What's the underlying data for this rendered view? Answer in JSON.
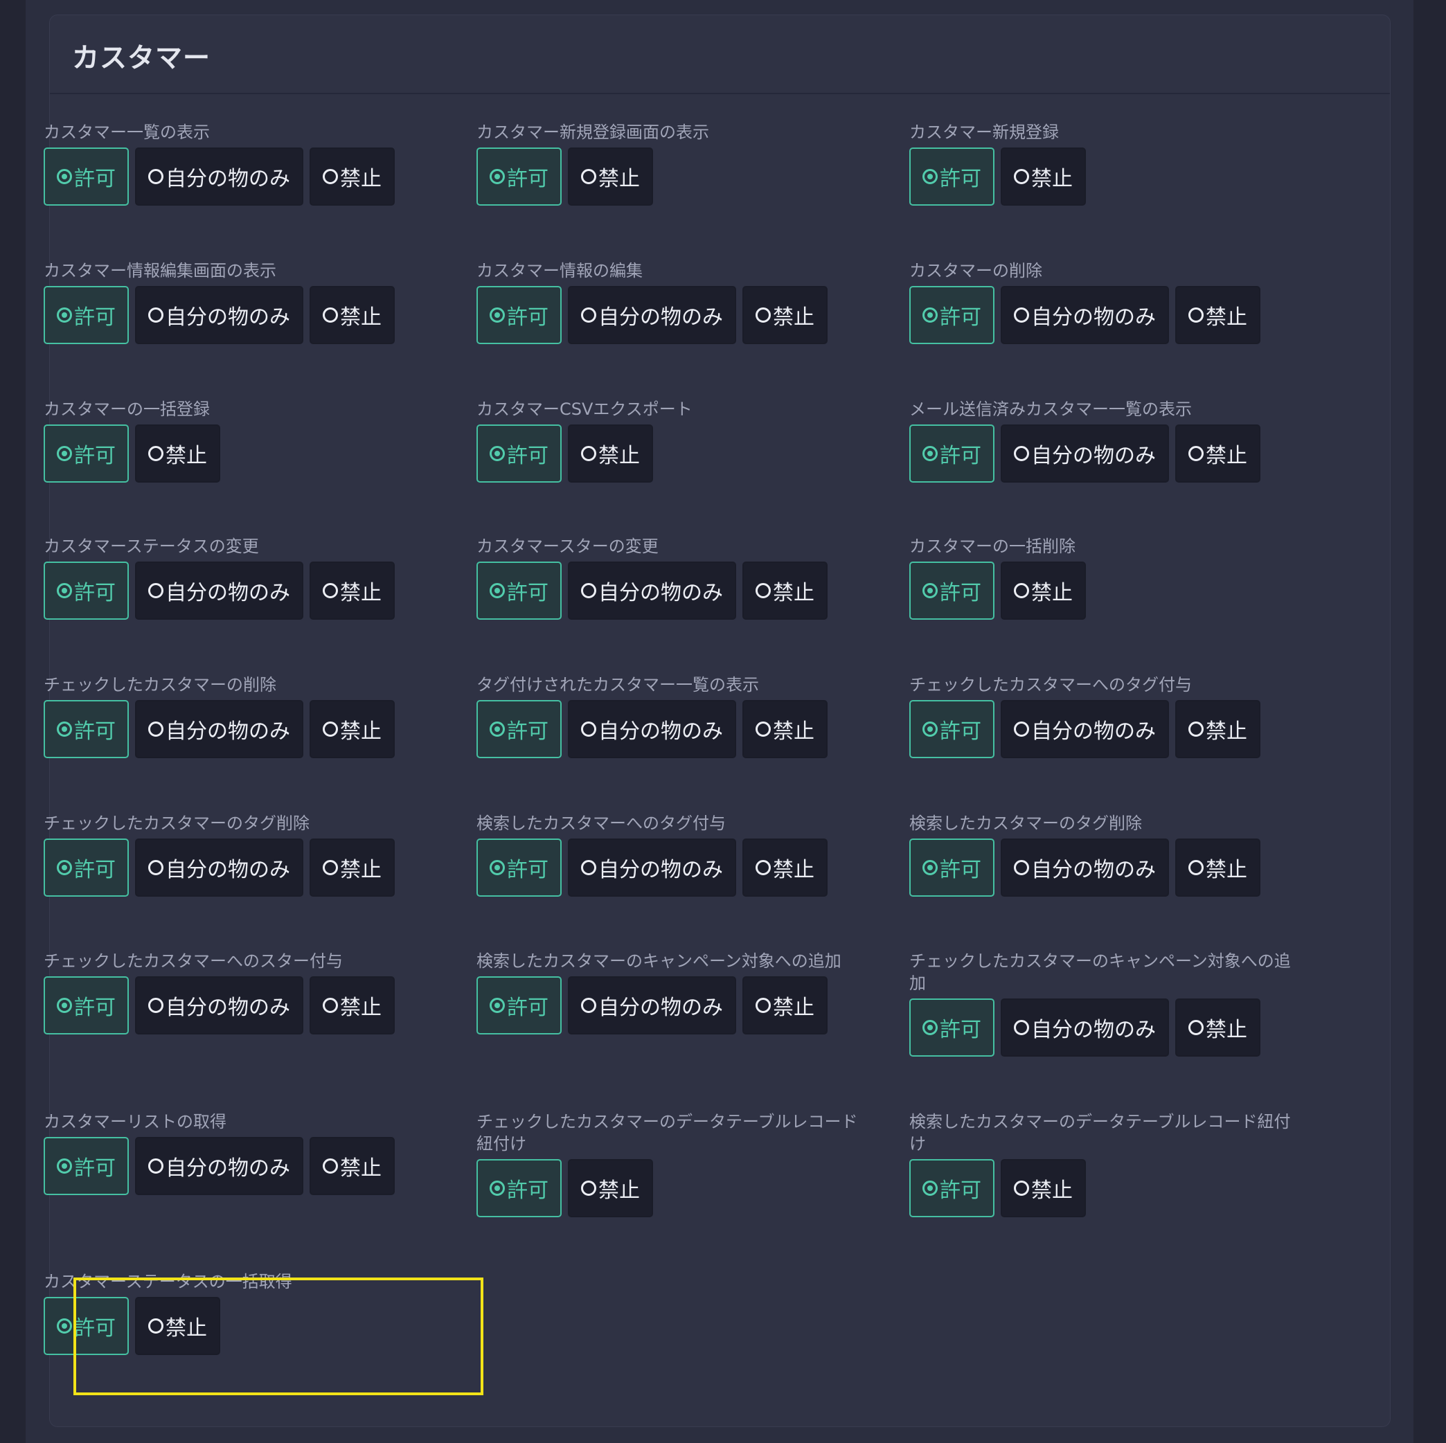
{
  "card": {
    "title": "カスタマー"
  },
  "colors": {
    "accent": "#45c0a2",
    "highlight": "#f2e318"
  },
  "option_labels": {
    "allow": "許可",
    "own": "自分の物のみ",
    "deny": "禁止"
  },
  "permissions": [
    {
      "label": "カスタマー一覧の表示",
      "options": [
        "allow",
        "own",
        "deny"
      ],
      "selected": "allow"
    },
    {
      "label": "カスタマー新規登録画面の表示",
      "options": [
        "allow",
        "deny"
      ],
      "selected": "allow"
    },
    {
      "label": "カスタマー新規登録",
      "options": [
        "allow",
        "deny"
      ],
      "selected": "allow"
    },
    {
      "label": "カスタマー情報編集画面の表示",
      "options": [
        "allow",
        "own",
        "deny"
      ],
      "selected": "allow"
    },
    {
      "label": "カスタマー情報の編集",
      "options": [
        "allow",
        "own",
        "deny"
      ],
      "selected": "allow"
    },
    {
      "label": "カスタマーの削除",
      "options": [
        "allow",
        "own",
        "deny"
      ],
      "selected": "allow"
    },
    {
      "label": "カスタマーの一括登録",
      "options": [
        "allow",
        "deny"
      ],
      "selected": "allow"
    },
    {
      "label": "カスタマーCSVエクスポート",
      "options": [
        "allow",
        "deny"
      ],
      "selected": "allow"
    },
    {
      "label": "メール送信済みカスタマー一覧の表示",
      "options": [
        "allow",
        "own",
        "deny"
      ],
      "selected": "allow"
    },
    {
      "label": "カスタマーステータスの変更",
      "options": [
        "allow",
        "own",
        "deny"
      ],
      "selected": "allow"
    },
    {
      "label": "カスタマースターの変更",
      "options": [
        "allow",
        "own",
        "deny"
      ],
      "selected": "allow"
    },
    {
      "label": "カスタマーの一括削除",
      "options": [
        "allow",
        "deny"
      ],
      "selected": "allow"
    },
    {
      "label": "チェックしたカスタマーの削除",
      "options": [
        "allow",
        "own",
        "deny"
      ],
      "selected": "allow"
    },
    {
      "label": "タグ付けされたカスタマー一覧の表示",
      "options": [
        "allow",
        "own",
        "deny"
      ],
      "selected": "allow"
    },
    {
      "label": "チェックしたカスタマーへのタグ付与",
      "options": [
        "allow",
        "own",
        "deny"
      ],
      "selected": "allow"
    },
    {
      "label": "チェックしたカスタマーのタグ削除",
      "options": [
        "allow",
        "own",
        "deny"
      ],
      "selected": "allow"
    },
    {
      "label": "検索したカスタマーへのタグ付与",
      "options": [
        "allow",
        "own",
        "deny"
      ],
      "selected": "allow"
    },
    {
      "label": "検索したカスタマーのタグ削除",
      "options": [
        "allow",
        "own",
        "deny"
      ],
      "selected": "allow"
    },
    {
      "label": "チェックしたカスタマーへのスター付与",
      "options": [
        "allow",
        "own",
        "deny"
      ],
      "selected": "allow"
    },
    {
      "label": "検索したカスタマーのキャンペーン対象への追加",
      "options": [
        "allow",
        "own",
        "deny"
      ],
      "selected": "allow"
    },
    {
      "label": "チェックしたカスタマーのキャンペーン対象への追加",
      "options": [
        "allow",
        "own",
        "deny"
      ],
      "selected": "allow"
    },
    {
      "label": "カスタマーリストの取得",
      "options": [
        "allow",
        "own",
        "deny"
      ],
      "selected": "allow"
    },
    {
      "label": "チェックしたカスタマーのデータテーブルレコード紐付け",
      "options": [
        "allow",
        "deny"
      ],
      "selected": "allow"
    },
    {
      "label": "検索したカスタマーのデータテーブルレコード紐付け",
      "options": [
        "allow",
        "deny"
      ],
      "selected": "allow"
    },
    {
      "label": "カスタマーステータスの一括取得",
      "options": [
        "allow",
        "deny"
      ],
      "selected": "allow",
      "highlighted": true
    }
  ]
}
